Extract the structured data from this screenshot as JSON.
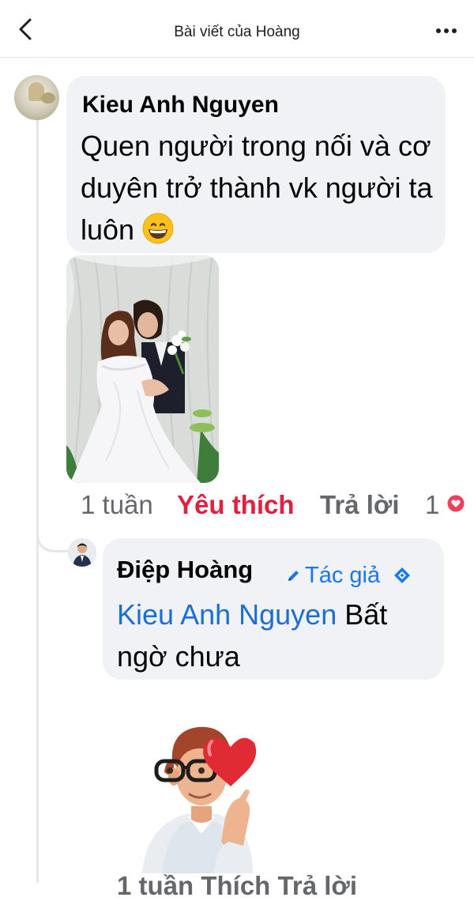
{
  "header": {
    "title": "Bài viết của Hoàng"
  },
  "comment": {
    "author": "Kieu Anh Nguyen",
    "text": "Quen người trong nối và cơ duyên trở thành vk người ta luôn",
    "emoji": "grinning-face",
    "time": "1 tuần",
    "like_label": "Yêu thích",
    "reply_label": "Trả lời",
    "reaction_count": "1",
    "reaction": "heart"
  },
  "reply": {
    "author": "Điệp Hoàng",
    "author_badge": "Tác giả",
    "mention": "Kieu Anh Nguyen",
    "text": " Bất ngờ chưa",
    "sticker": "avatar-heart-sticker",
    "meta_cutoff": "1 tuần   Thích   Trả lời"
  },
  "colors": {
    "like_red": "#e41e3f",
    "link_blue": "#1a6ed8",
    "bubble_gray": "#f0f2f5",
    "meta_gray": "#65676b"
  }
}
